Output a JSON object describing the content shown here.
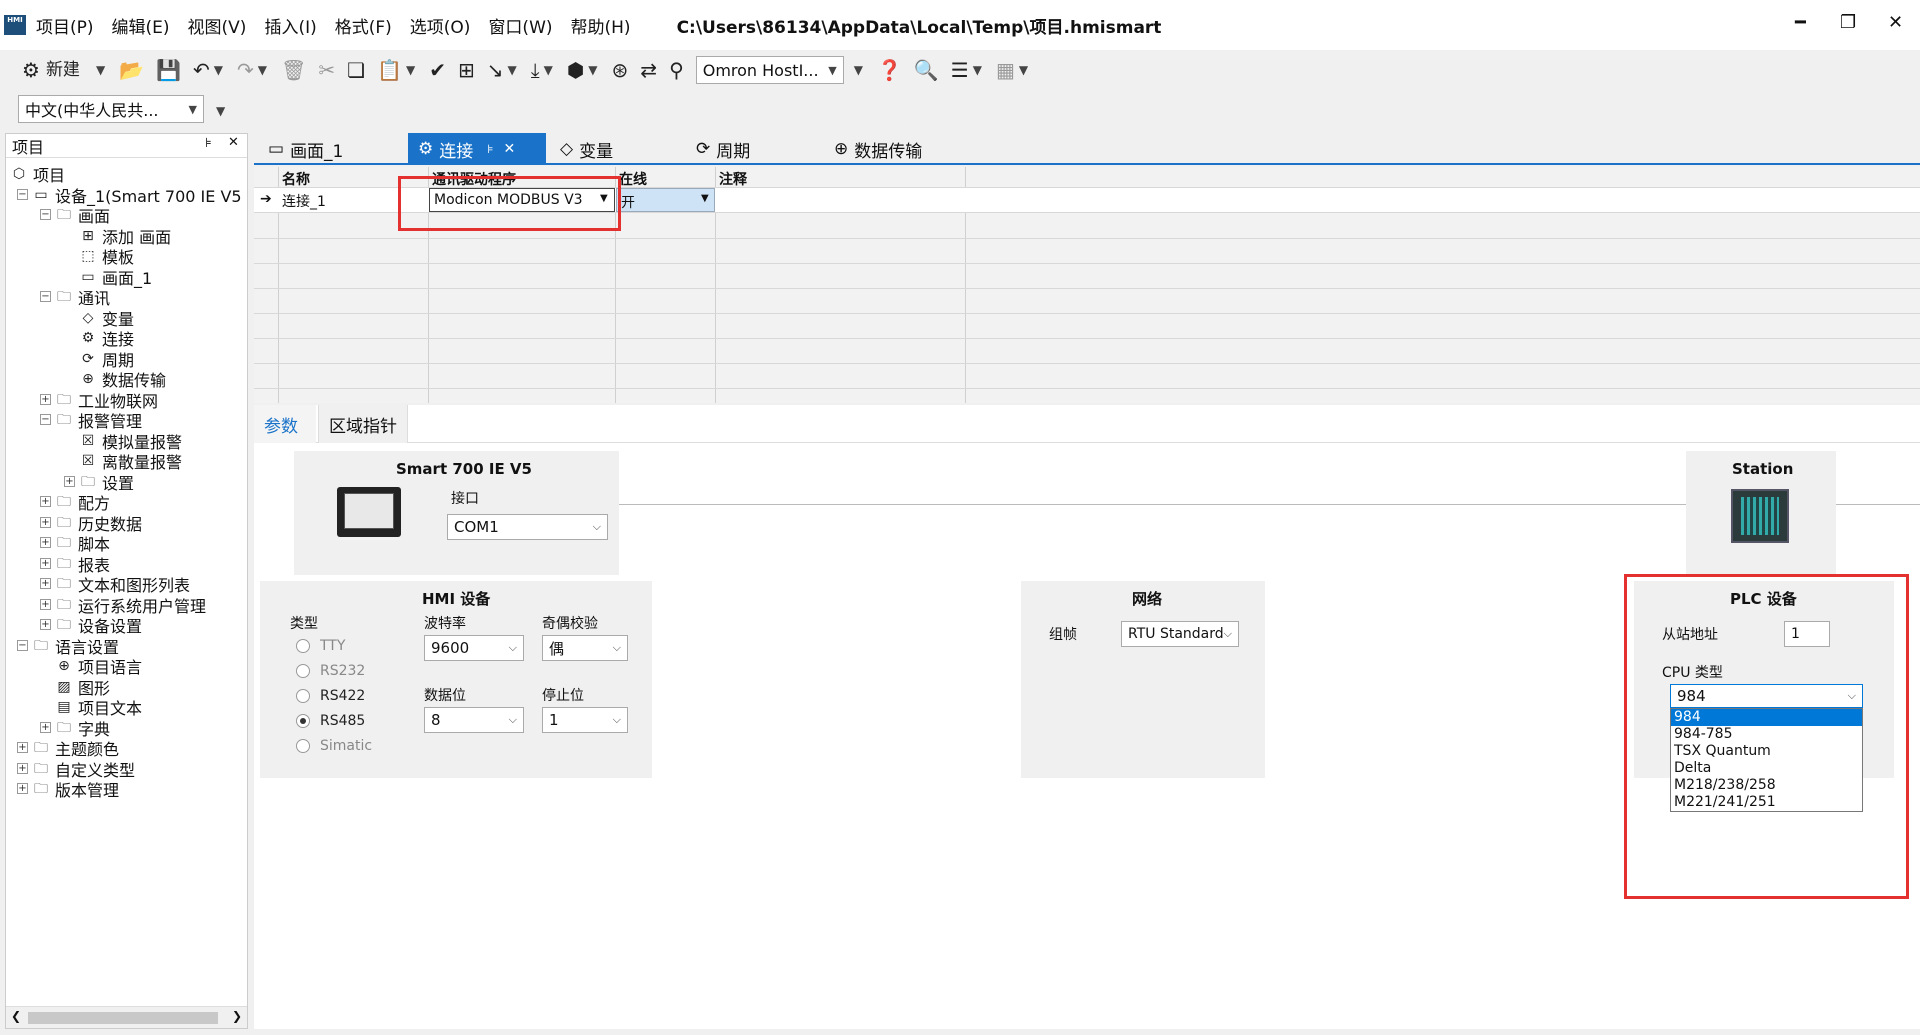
{
  "window": {
    "title_path": "C:\\Users\\86134\\AppData\\Local\\Temp\\项目.hmismart",
    "menus": [
      "项目(P)",
      "编辑(E)",
      "视图(V)",
      "插入(I)",
      "格式(F)",
      "选项(O)",
      "窗口(W)",
      "帮助(H)"
    ],
    "min_glyph": "━",
    "max_glyph": "❐",
    "close_glyph": "✕"
  },
  "toolbar": {
    "new_label": "新建",
    "device_combo": "Omron HostI...",
    "language_combo": "中文(中华人民共..."
  },
  "tree": {
    "header": "项目",
    "pin_glyph": "⊧",
    "close_glyph": "✕",
    "items": [
      {
        "label": "项目",
        "icon": "cube-icon"
      },
      {
        "label": "设备_1(Smart 700 IE V5",
        "icon": "device-icon"
      },
      {
        "label": "画面",
        "icon": "folder-icon"
      },
      {
        "label": "添加 画面",
        "icon": "add-screen-icon"
      },
      {
        "label": "模板",
        "icon": "template-icon"
      },
      {
        "label": "画面_1",
        "icon": "screen-icon"
      },
      {
        "label": "通讯",
        "icon": "folder-icon"
      },
      {
        "label": "变量",
        "icon": "tag-icon"
      },
      {
        "label": "连接",
        "icon": "connection-icon"
      },
      {
        "label": "周期",
        "icon": "cycle-icon"
      },
      {
        "label": "数据传输",
        "icon": "transfer-icon"
      },
      {
        "label": "工业物联网",
        "icon": "folder-icon"
      },
      {
        "label": "报警管理",
        "icon": "folder-icon"
      },
      {
        "label": "模拟量报警",
        "icon": "alarm-icon"
      },
      {
        "label": "离散量报警",
        "icon": "alarm-icon"
      },
      {
        "label": "设置",
        "icon": "folder-icon"
      },
      {
        "label": "配方",
        "icon": "folder-icon"
      },
      {
        "label": "历史数据",
        "icon": "folder-icon"
      },
      {
        "label": "脚本",
        "icon": "folder-icon"
      },
      {
        "label": "报表",
        "icon": "folder-icon"
      },
      {
        "label": "文本和图形列表",
        "icon": "folder-icon"
      },
      {
        "label": "运行系统用户管理",
        "icon": "folder-icon"
      },
      {
        "label": "设备设置",
        "icon": "folder-icon"
      },
      {
        "label": "语言设置",
        "icon": "folder-icon"
      },
      {
        "label": "项目语言",
        "icon": "globe-icon"
      },
      {
        "label": "图形",
        "icon": "image-icon"
      },
      {
        "label": "项目文本",
        "icon": "document-icon"
      },
      {
        "label": "字典",
        "icon": "folder-icon"
      },
      {
        "label": "主题颜色",
        "icon": "folder-icon"
      },
      {
        "label": "自定义类型",
        "icon": "udt-folder-icon"
      },
      {
        "label": "版本管理",
        "icon": "folder-icon"
      }
    ]
  },
  "tabs": [
    {
      "label": "画面_1",
      "icon": "screen-icon"
    },
    {
      "label": "连接",
      "icon": "connection-icon"
    },
    {
      "label": "变量",
      "icon": "tag-icon"
    },
    {
      "label": "周期",
      "icon": "cycle-icon"
    },
    {
      "label": "数据传输",
      "icon": "transfer-icon"
    }
  ],
  "grid": {
    "columns": [
      "名称",
      "通讯驱动程序",
      "在线",
      "注释"
    ],
    "rows": [
      {
        "name": "连接_1",
        "driver": "Modicon MODBUS V3",
        "online": "开",
        "comment": ""
      }
    ]
  },
  "subtabs": [
    "参数",
    "区域指针"
  ],
  "params": {
    "hmi_device_name": "Smart 700 IE V5",
    "interface_label": "接口",
    "interface_value": "COM1",
    "station_label": "Station",
    "hmi_panel": {
      "title": "HMI 设备",
      "type_label": "类型",
      "types": [
        {
          "label": "TTY",
          "selected": false,
          "enabled": false
        },
        {
          "label": "RS232",
          "selected": false,
          "enabled": false
        },
        {
          "label": "RS422",
          "selected": false,
          "enabled": true
        },
        {
          "label": "RS485",
          "selected": true,
          "enabled": true
        },
        {
          "label": "Simatic",
          "selected": false,
          "enabled": false
        }
      ],
      "baud_label": "波特率",
      "baud_value": "9600",
      "parity_label": "奇偶校验",
      "parity_value": "偶",
      "databits_label": "数据位",
      "databits_value": "8",
      "stopbits_label": "停止位",
      "stopbits_value": "1"
    },
    "network_panel": {
      "title": "网络",
      "frame_label": "组帧",
      "frame_value": "RTU Standard"
    },
    "plc_panel": {
      "title": "PLC 设备",
      "slave_label": "从站地址",
      "slave_value": "1",
      "cpu_label": "CPU 类型",
      "cpu_value": "984",
      "cpu_options": [
        "984",
        "984-785",
        "TSX Quantum",
        "Delta",
        "M218/238/258",
        "M221/241/251"
      ]
    }
  },
  "colors": {
    "accent": "#1a73c9",
    "highlight": "#e53030",
    "selection": "#0078d7"
  }
}
